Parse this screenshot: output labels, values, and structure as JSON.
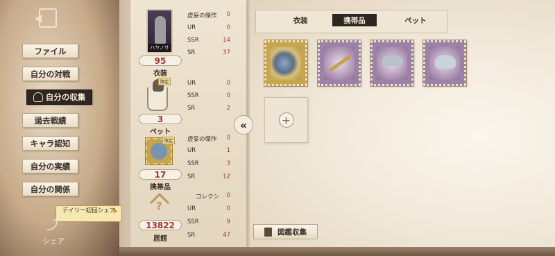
{
  "nav": {
    "items": [
      {
        "label": "ファイル"
      },
      {
        "label": "自分の対戦"
      },
      {
        "label": "自分の収集"
      },
      {
        "label": "過去戦績"
      },
      {
        "label": "キャラ認知"
      },
      {
        "label": "自分の実績"
      },
      {
        "label": "自分の関係"
      }
    ],
    "daily_label": "デイリー初回シェア",
    "share_label": "シェア"
  },
  "collection": {
    "costume": {
      "portrait_name": "ハヤノサ",
      "count": "95",
      "label": "衣装",
      "stats": [
        {
          "label": "虚妄の傑作",
          "value": "0"
        },
        {
          "label": "UR",
          "value": "0"
        },
        {
          "label": "SSR",
          "value": "14"
        },
        {
          "label": "SR",
          "value": "37"
        }
      ]
    },
    "pet": {
      "tag": "限定",
      "count": "3",
      "label": "ペット",
      "stats": [
        {
          "label": "UR",
          "value": "0"
        },
        {
          "label": "SSR",
          "value": "0"
        },
        {
          "label": "SR",
          "value": "2"
        }
      ]
    },
    "accessory": {
      "tag": "限定",
      "count": "17",
      "label": "携帯品",
      "stats": [
        {
          "label": "虚妄の傑作",
          "value": "0"
        },
        {
          "label": "UR",
          "value": "1"
        },
        {
          "label": "SSR",
          "value": "3"
        },
        {
          "label": "SR",
          "value": "12"
        }
      ]
    },
    "house": {
      "count": "13822",
      "label": "居館",
      "stats": [
        {
          "label": "コレクシ",
          "value": "0"
        },
        {
          "label": "UR",
          "value": "0"
        },
        {
          "label": "SSR",
          "value": "9"
        },
        {
          "label": "SR",
          "value": "47"
        }
      ]
    }
  },
  "tabs": {
    "items": [
      {
        "label": "衣装"
      },
      {
        "label": "携帯品"
      },
      {
        "label": "ペット"
      }
    ],
    "active": "携帯品"
  },
  "slots": [
    {
      "icon": "jeweled-orb-accessory-icon",
      "style": "gold"
    },
    {
      "icon": "ornate-rod-accessory-icon",
      "style": "purple"
    },
    {
      "icon": "crystal-bird-accessory-icon",
      "style": "purple"
    },
    {
      "icon": "shell-pearl-accessory-icon",
      "style": "purple"
    }
  ],
  "footer": {
    "catalog_label": "図鑑収集"
  },
  "colors": {
    "accent_value": "#a3343b",
    "active_tab": "#2e2620"
  }
}
